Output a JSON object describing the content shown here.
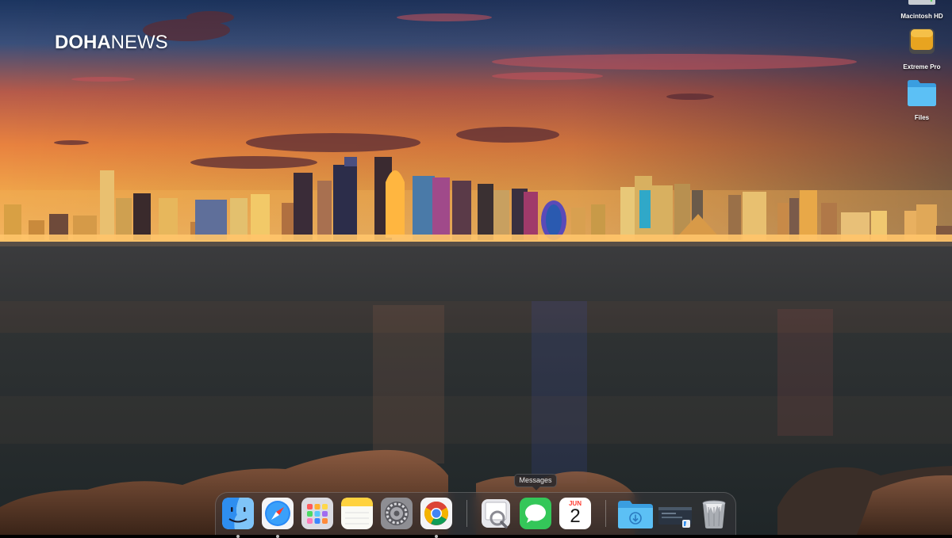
{
  "brand": {
    "part1": "DOHA",
    "part2": "NEWS"
  },
  "desktop_icons": [
    {
      "name": "drive-icon",
      "label": "Macintosh HD"
    },
    {
      "name": "external-drive-icon",
      "label": "Extreme Pro"
    },
    {
      "name": "folder-icon",
      "label": "Files"
    }
  ],
  "dock": {
    "tooltip": "Messages",
    "calendar": {
      "month": "JUN",
      "day": "2"
    },
    "items": [
      {
        "name": "finder-icon",
        "app": "Finder",
        "running": true
      },
      {
        "name": "safari-icon",
        "app": "Safari",
        "running": true
      },
      {
        "name": "launchpad-icon",
        "app": "Launchpad",
        "running": false
      },
      {
        "name": "notes-icon",
        "app": "Notes",
        "running": false
      },
      {
        "name": "system-settings-icon",
        "app": "System Settings",
        "running": false
      },
      {
        "name": "chrome-icon",
        "app": "Chrome",
        "running": true
      },
      {
        "name": "preview-icon",
        "app": "Preview",
        "running": false
      },
      {
        "name": "messages-icon",
        "app": "Messages",
        "running": false
      },
      {
        "name": "calendar-icon",
        "app": "Calendar",
        "running": false
      },
      {
        "name": "downloads-folder-icon",
        "app": "Downloads",
        "running": false
      },
      {
        "name": "minimized-window-icon",
        "app": "Window",
        "running": false
      },
      {
        "name": "trash-icon",
        "app": "Trash",
        "running": false
      }
    ]
  },
  "colors": {
    "sky_top": "#1d3a6e",
    "sky_glow": "#f39a3c",
    "water": "#2a2e30",
    "messages_green": "#34c759",
    "folder_blue": "#4fb3ee"
  }
}
